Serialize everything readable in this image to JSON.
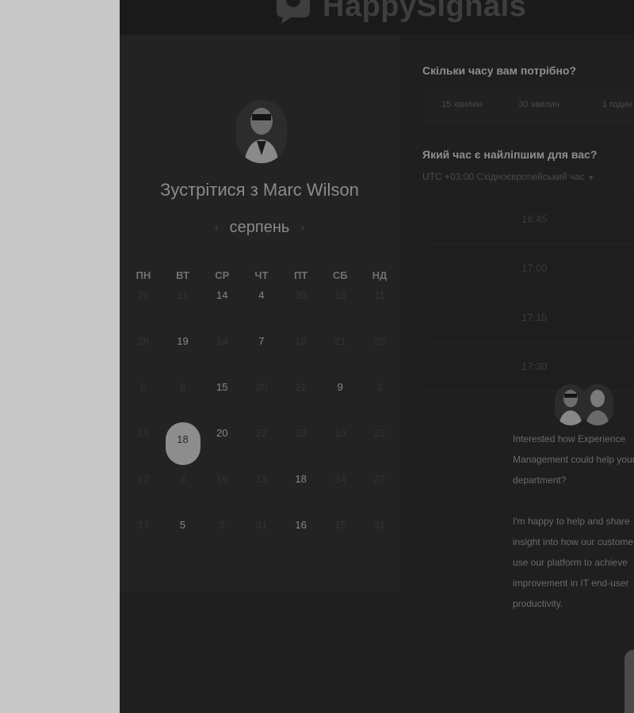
{
  "brand": {
    "name": "HappySignals",
    "icon": "speech-bubble-logo-icon"
  },
  "meeting": {
    "prefix": "Зустрітися з",
    "host": "Marc Wilson",
    "month": "серпень",
    "prev_icon": "‹",
    "next_icon": "›"
  },
  "calendar": {
    "weekdays": [
      "ПН",
      "ВТ",
      "СР",
      "ЧТ",
      "ПТ",
      "СБ",
      "НД"
    ],
    "weeks": [
      [
        {
          "d": "26",
          "s": "muted"
        },
        {
          "d": "11",
          "s": "muted"
        },
        {
          "d": "14",
          "s": "avail"
        },
        {
          "d": "4",
          "s": "avail"
        },
        {
          "d": "30",
          "s": "muted"
        },
        {
          "d": "16",
          "s": "muted"
        },
        {
          "d": "11",
          "s": "muted"
        }
      ],
      [
        {
          "d": "28",
          "s": "muted"
        },
        {
          "d": "19",
          "s": "avail"
        },
        {
          "d": "14",
          "s": "muted"
        },
        {
          "d": "7",
          "s": "avail"
        },
        {
          "d": "18",
          "s": "muted"
        },
        {
          "d": "21",
          "s": "muted"
        },
        {
          "d": "20",
          "s": "muted"
        }
      ],
      [
        {
          "d": "6",
          "s": "muted"
        },
        {
          "d": "8",
          "s": "muted"
        },
        {
          "d": "15",
          "s": "avail"
        },
        {
          "d": "20",
          "s": "muted"
        },
        {
          "d": "21",
          "s": "muted"
        },
        {
          "d": "9",
          "s": "avail"
        },
        {
          "d": "2",
          "s": "muted"
        }
      ],
      [
        {
          "d": "15",
          "s": "muted"
        },
        {
          "d": "18",
          "s": "selected"
        },
        {
          "d": "20",
          "s": "avail"
        },
        {
          "d": "22",
          "s": "muted"
        },
        {
          "d": "23",
          "s": "muted"
        },
        {
          "d": "10",
          "s": "muted"
        },
        {
          "d": "22",
          "s": "muted"
        }
      ],
      [
        {
          "d": "12",
          "s": "muted"
        },
        {
          "d": "3",
          "s": "muted"
        },
        {
          "d": "16",
          "s": "muted"
        },
        {
          "d": "13",
          "s": "muted"
        },
        {
          "d": "18",
          "s": "avail"
        },
        {
          "d": "24",
          "s": "muted"
        },
        {
          "d": "27",
          "s": "muted"
        }
      ],
      [
        {
          "d": "17",
          "s": "muted"
        },
        {
          "d": "5",
          "s": "avail"
        },
        {
          "d": "2",
          "s": "muted"
        },
        {
          "d": "31",
          "s": "muted"
        },
        {
          "d": "16",
          "s": "avail"
        },
        {
          "d": "15",
          "s": "muted"
        },
        {
          "d": "31",
          "s": "muted"
        }
      ]
    ]
  },
  "duration": {
    "question": "Скільки часу вам потрібно?",
    "options": [
      "15 хвилин",
      "30 хвилин",
      "1 годин"
    ]
  },
  "time": {
    "question": "Який час є найліпшим для вас?",
    "timezone": "UTC +03:00 Східноєвропейський час",
    "slots": [
      "16:45",
      "17:00",
      "17:15",
      "17:30"
    ]
  },
  "message": {
    "p1": [
      "Interested how Experience",
      "Management could help your",
      "department?"
    ],
    "p2": [
      "I'm happy to help and share",
      "insight into how our customers",
      "use our platform to achieve",
      "improvement in IT end-user",
      "productivity."
    ]
  }
}
